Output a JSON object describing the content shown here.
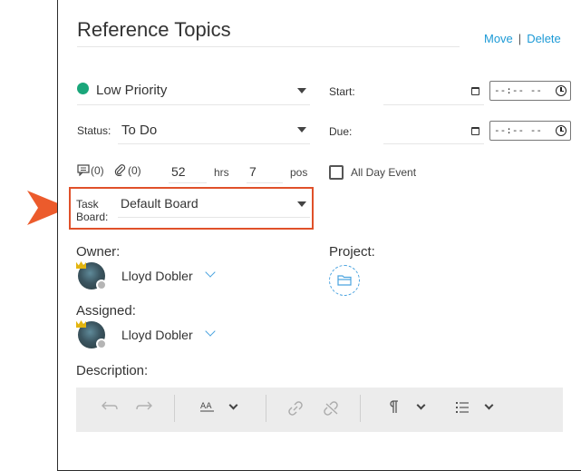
{
  "header": {
    "title": "Reference Topics",
    "move_label": "Move",
    "separator": "|",
    "delete_label": "Delete"
  },
  "priority": {
    "value": "Low Priority",
    "color": "#1aa67a"
  },
  "status": {
    "label": "Status:",
    "value": "To Do"
  },
  "start": {
    "label": "Start:",
    "time_placeholder": "--:-- --"
  },
  "due": {
    "label": "Due:",
    "time_placeholder": "--:-- --"
  },
  "counts": {
    "comments": "(0)",
    "attachments": "(0)",
    "hours_value": "52",
    "hours_unit": "hrs",
    "pos_value": "7",
    "pos_unit": "pos"
  },
  "all_day": {
    "label": "All Day Event",
    "checked": false
  },
  "task_board": {
    "label_line1": "Task",
    "label_line2": "Board:",
    "value": "Default Board"
  },
  "owner": {
    "label": "Owner:",
    "name": "Lloyd Dobler"
  },
  "assigned": {
    "label": "Assigned:",
    "name": "Lloyd Dobler"
  },
  "project": {
    "label": "Project:"
  },
  "description": {
    "label": "Description:"
  },
  "toolbar": {
    "icons": [
      "undo-icon",
      "redo-icon",
      "font-size-icon",
      "link-icon",
      "unlink-icon",
      "paragraph-icon",
      "list-icon"
    ]
  },
  "colors": {
    "accent": "#1c9ad6",
    "highlight": "#e0512a",
    "status_dot": "#1aa67a"
  }
}
